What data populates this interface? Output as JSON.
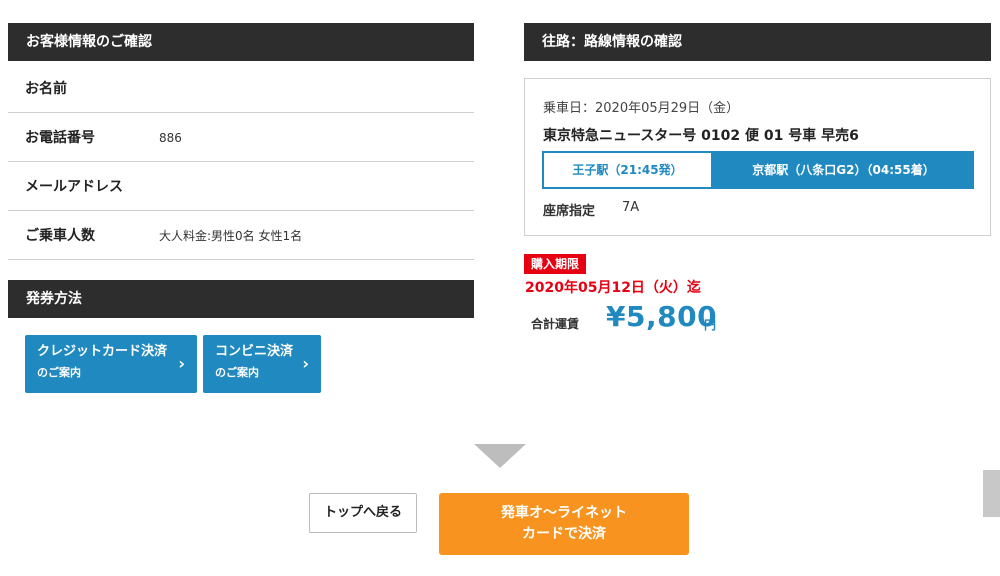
{
  "customer": {
    "header": "お客様情報のご確認",
    "rows": [
      {
        "label": "お名前",
        "value": ""
      },
      {
        "label": "お電話番号",
        "value": "886"
      },
      {
        "label": "メールアドレス",
        "value": ""
      },
      {
        "label": "ご乗車人数",
        "value": "大人料金:男性0名  女性1名"
      }
    ]
  },
  "ticketing": {
    "header": "発券方法",
    "buttons": [
      {
        "line1": "クレジットカード決済",
        "line2": "のご案内"
      },
      {
        "line1": "コンビニ決済",
        "line2": "のご案内"
      }
    ]
  },
  "route": {
    "header": "往路：路線情報の確認",
    "date": "乗車日：2020年05月29日（金）",
    "train": "東京特急ニュースター号 0102 便 01 号車 早売6",
    "from": "王子駅（21:45発）",
    "to": "京都駅（八条口G2）（04:55着）",
    "seat_label": "座席指定",
    "seat_value": "7A"
  },
  "deadline": {
    "badge": "購入期限",
    "date": "2020年05月12日（火）迄"
  },
  "fare": {
    "label": "合計運賃",
    "value": "¥5,800",
    "unit": "円"
  },
  "actions": {
    "back": "トップへ戻る",
    "pay_line1": "発車オ～ライネット",
    "pay_line2": "カードで決済"
  },
  "colors": {
    "header_bg": "#2d2d2d",
    "accent_blue": "#2089c0",
    "alert_red": "#e60012",
    "pay_orange": "#f7931e"
  }
}
